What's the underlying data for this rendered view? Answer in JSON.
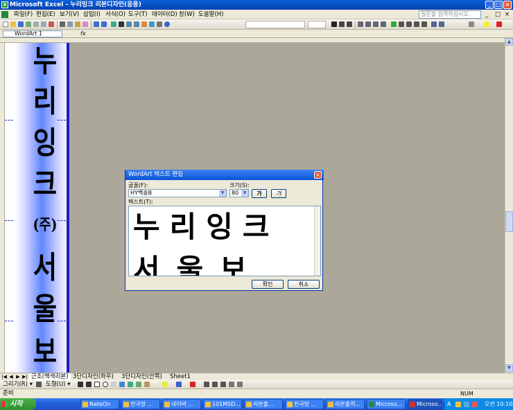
{
  "window": {
    "title": "Microsoft Excel - 누리잉크 리본디자인(응용)",
    "controls": [
      "_",
      "□",
      "×"
    ]
  },
  "menubar": {
    "items": [
      "파일(F)",
      "편집(E)",
      "보기(V)",
      "삽입(I)",
      "서식(O)",
      "도구(T)",
      "데이터(D)",
      "창(W)",
      "도움말(H)"
    ],
    "help_placeholder": "질문을 입력하십시오.",
    "window_controls": [
      "_",
      "□",
      "×"
    ]
  },
  "formula_bar": {
    "name_box": "WordArt 1",
    "fx": "fx"
  },
  "worksheet": {
    "wordart_vertical_chars": [
      "누",
      "리",
      "잉",
      "크",
      "(주)",
      "서",
      "울",
      "보"
    ],
    "colors": {
      "banner_center": "#5f86ff",
      "banner_edge": "#1c1cc8",
      "page_break": "#1c2bd8"
    }
  },
  "sheet_tabs": {
    "nav": [
      "|◀",
      "◀",
      "▶",
      "▶|"
    ],
    "tabs": [
      "근조(백색리본)",
      "3단디자인(좌우)",
      "3단디자인(안쪽)",
      "Sheet1"
    ]
  },
  "draw_toolbar": {
    "draw_label": "그리기(R) ▾",
    "shapes_label": "도형(U) ▾"
  },
  "status_bar": {
    "ready": "준비",
    "num": "NUM"
  },
  "taskbar": {
    "start": "시작",
    "tasks": [
      "NateOn",
      "전국망 ...",
      "네이버 ...",
      "101MSD...",
      "리본출...",
      "전국망 ...",
      "리본출력...",
      "Microso...",
      "Microso..."
    ],
    "tray_time": "오전 10:10",
    "tray_lang": "A"
  },
  "dialog": {
    "title": "WordArt 텍스트 편집",
    "font_label": "글꼴(F):",
    "font_value": "HY백송B",
    "size_label": "크기(S):",
    "size_value": "80",
    "bold_label": "가",
    "italic_label": "가",
    "text_label": "텍스트(T):",
    "text_line1": "누리잉크",
    "text_line2": "서울보",
    "ok_label": "확인",
    "cancel_label": "취소"
  }
}
